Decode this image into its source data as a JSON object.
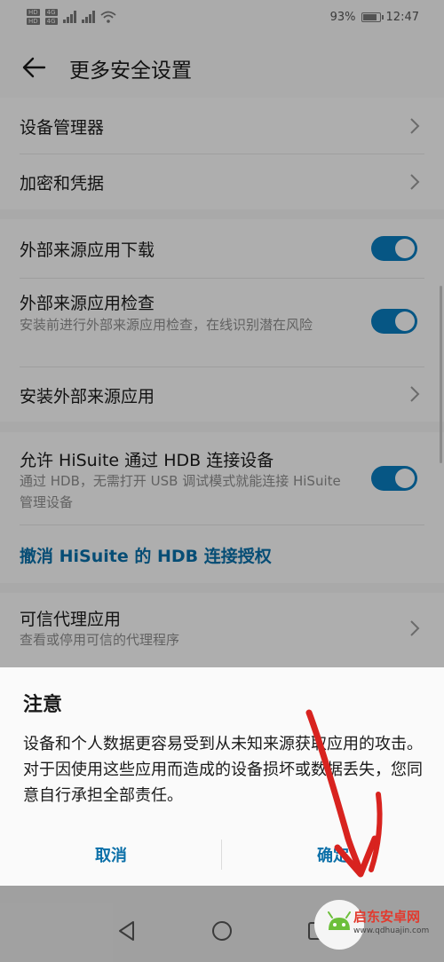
{
  "status_bar": {
    "sim1_tags": [
      "HD",
      "HD"
    ],
    "sim2_tags": [
      "4G",
      "4G"
    ],
    "battery": "93%",
    "battery_level": 0.93,
    "time": "12:47"
  },
  "header": {
    "title": "更多安全设置"
  },
  "group1": {
    "items": [
      {
        "label": "设备管理器"
      },
      {
        "label": "加密和凭据"
      }
    ]
  },
  "group2": {
    "external_download": {
      "label": "外部来源应用下载",
      "on": true
    },
    "external_check": {
      "label": "外部来源应用检查",
      "sub": "安装前进行外部来源应用检查，在线识别潜在风险",
      "on": true
    },
    "install_external": {
      "label": "安装外部来源应用"
    }
  },
  "group3": {
    "hisuite_hdb": {
      "label": "允许 HiSuite 通过 HDB 连接设备",
      "sub": "通过 HDB，无需打开 USB 调试模式就能连接 HiSuite 管理设备",
      "on": true
    },
    "revoke_link": "撤消 HiSuite 的 HDB 连接授权"
  },
  "group4": {
    "trusted_agents": {
      "label": "可信代理应用",
      "sub": "查看或停用可信的代理程序"
    }
  },
  "dialog": {
    "title": "注意",
    "message": "设备和个人数据更容易受到从未知来源获取应用的攻击。对于因使用这些应用而造成的设备损坏或数据丢失，您同意自行承担全部责任。",
    "cancel_label": "取消",
    "confirm_label": "确定"
  },
  "colors": {
    "accent": "#0a7bbd",
    "link": "#0a6fa8",
    "annotation": "#d8231f"
  },
  "watermark": {
    "title": "启东安卓网",
    "url": "www.qdhuajin.com"
  }
}
